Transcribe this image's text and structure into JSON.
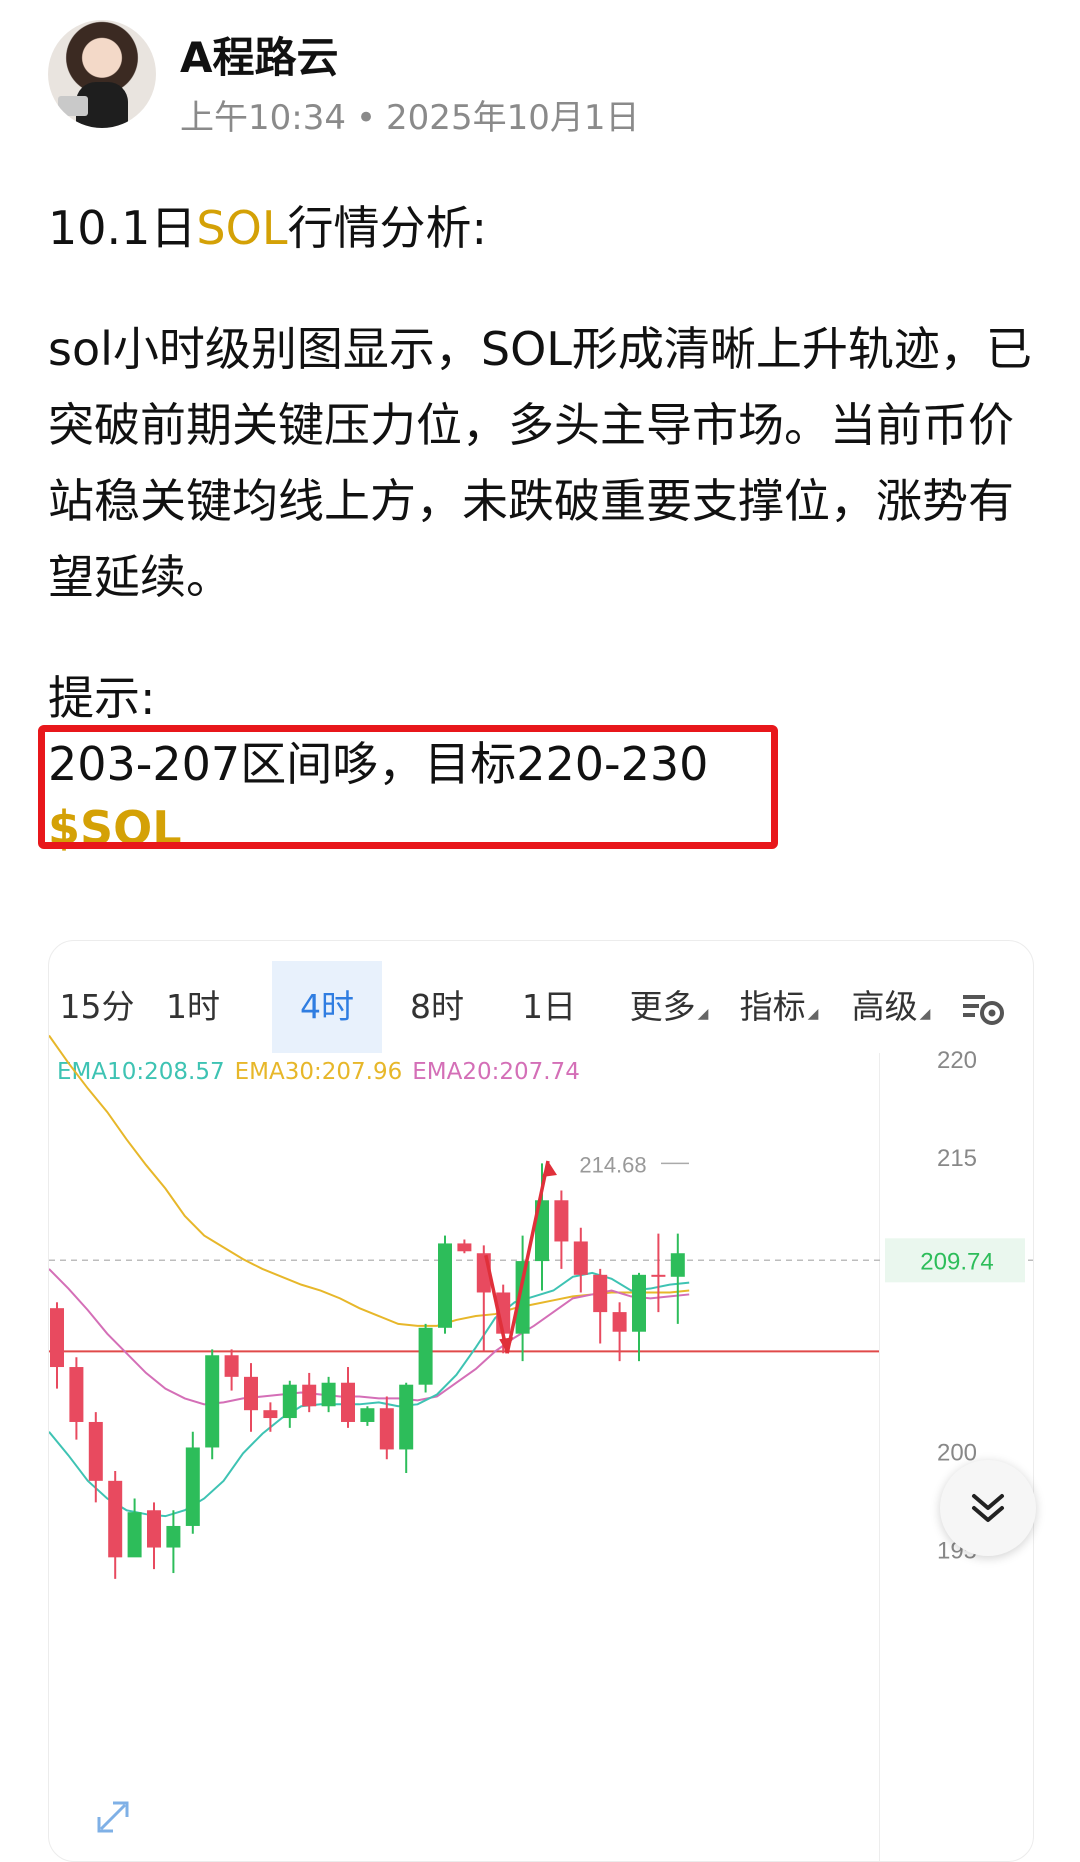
{
  "author": {
    "name": "A程路云",
    "time": "上午10:34",
    "separator": "•",
    "date": "2025年10月1日"
  },
  "post": {
    "title_prefix": "10.1日",
    "title_highlight": "SOL",
    "title_suffix": "行情分析:",
    "body": "sol小时级别图显示，SOL形成清晰上升轨迹，已突破前期关键压力位，多头主导市场。当前币价站稳关键均线上方，未跌破重要支撑位，涨势有望延续。",
    "hint_label": "提示:",
    "hint_text": "203-207区间哆，目标220-230",
    "tag": "$SOL"
  },
  "chart": {
    "tabs": [
      "15分",
      "1时",
      "4时",
      "8时",
      "1日",
      "更多",
      "指标",
      "高级"
    ],
    "active_tab": "4时",
    "settings_icon": "chart-settings-icon",
    "legend": {
      "ema10": "EMA10:208.57",
      "ema30": "EMA30:207.96",
      "ema20": "EMA20:207.74"
    },
    "price_labels": {
      "high": "214.68",
      "current": "209.74"
    },
    "colors": {
      "up": "#2dbd5a",
      "down": "#e84a5f",
      "ema10": "#3ec3b3",
      "ema30": "#e7b72a",
      "ema20": "#d46fb7",
      "support_line": "#e04a4a",
      "arrow": "#e0303a",
      "accent": "#2f7de1"
    }
  },
  "chart_data": {
    "type": "candlestick",
    "yticks": [
      220,
      215,
      200,
      195
    ],
    "ylim": [
      193.2,
      221.4
    ],
    "current_price": 209.74,
    "support_level": 205.1,
    "candles": [
      {
        "o": 207.3,
        "h": 207.6,
        "c": 204.3,
        "l": 203.2
      },
      {
        "o": 204.3,
        "h": 204.8,
        "c": 201.5,
        "l": 200.6
      },
      {
        "o": 201.5,
        "h": 202.0,
        "c": 198.5,
        "l": 197.4
      },
      {
        "o": 198.5,
        "h": 199.0,
        "c": 194.6,
        "l": 193.5
      },
      {
        "o": 194.6,
        "h": 197.6,
        "c": 196.9,
        "l": 195.6
      },
      {
        "o": 197.0,
        "h": 197.4,
        "c": 195.1,
        "l": 194.0
      },
      {
        "o": 195.1,
        "h": 197.0,
        "c": 196.2,
        "l": 193.8
      },
      {
        "o": 196.2,
        "h": 201.0,
        "c": 200.2,
        "l": 195.8
      },
      {
        "o": 200.2,
        "h": 205.2,
        "c": 204.9,
        "l": 199.6
      },
      {
        "o": 204.9,
        "h": 205.2,
        "c": 203.8,
        "l": 203.1
      },
      {
        "o": 203.8,
        "h": 204.5,
        "c": 202.1,
        "l": 201.0
      },
      {
        "o": 202.1,
        "h": 202.5,
        "c": 201.7,
        "l": 201.0
      },
      {
        "o": 201.7,
        "h": 203.6,
        "c": 203.4,
        "l": 201.2
      },
      {
        "o": 203.4,
        "h": 204.0,
        "c": 202.3,
        "l": 202.0
      },
      {
        "o": 202.3,
        "h": 203.8,
        "c": 203.5,
        "l": 202.0
      },
      {
        "o": 203.5,
        "h": 204.3,
        "c": 201.5,
        "l": 201.2
      },
      {
        "o": 201.5,
        "h": 202.3,
        "c": 202.2,
        "l": 201.3
      },
      {
        "o": 202.2,
        "h": 202.8,
        "c": 200.1,
        "l": 199.6
      },
      {
        "o": 200.1,
        "h": 203.5,
        "c": 203.4,
        "l": 198.9
      },
      {
        "o": 203.4,
        "h": 206.5,
        "c": 206.3,
        "l": 203.0
      },
      {
        "o": 206.3,
        "h": 211.0,
        "c": 210.6,
        "l": 206.0
      },
      {
        "o": 210.6,
        "h": 210.8,
        "c": 210.2,
        "l": 210.1
      },
      {
        "o": 210.1,
        "h": 210.5,
        "c": 208.1,
        "l": 205.1
      },
      {
        "o": 208.1,
        "h": 208.5,
        "c": 206.0,
        "l": 205.0
      },
      {
        "o": 206.0,
        "h": 211.0,
        "c": 209.7,
        "l": 204.6
      },
      {
        "o": 209.7,
        "h": 214.68,
        "c": 212.8,
        "l": 208.2
      },
      {
        "o": 212.8,
        "h": 213.3,
        "c": 210.7,
        "l": 209.3
      },
      {
        "o": 210.7,
        "h": 211.4,
        "c": 209.0,
        "l": 208.1
      },
      {
        "o": 209.0,
        "h": 209.3,
        "c": 207.1,
        "l": 205.5
      },
      {
        "o": 207.1,
        "h": 207.6,
        "c": 206.1,
        "l": 204.6
      },
      {
        "o": 206.1,
        "h": 209.1,
        "c": 209.0,
        "l": 204.6
      },
      {
        "o": 209.0,
        "h": 211.1,
        "c": 208.9,
        "l": 207.1
      },
      {
        "o": 208.9,
        "h": 211.1,
        "c": 210.1,
        "l": 206.5
      }
    ],
    "ema10": [
      201.0,
      199.8,
      198.5,
      197.6,
      197.0,
      196.8,
      196.7,
      197.0,
      197.6,
      198.5,
      199.9,
      200.9,
      201.7,
      202.3,
      202.4,
      202.4,
      202.4,
      202.5,
      202.3,
      202.4,
      202.9,
      203.9,
      205.3,
      206.8,
      207.6,
      207.9,
      208.2,
      208.9,
      209.1,
      208.8,
      208.2,
      208.3,
      208.5,
      208.6
    ],
    "ema20": [
      209.3,
      208.3,
      207.2,
      206.0,
      205.0,
      204.0,
      203.2,
      202.7,
      202.4,
      202.5,
      202.7,
      202.8,
      202.9,
      203.0,
      202.9,
      202.8,
      202.8,
      202.7,
      202.7,
      202.6,
      202.8,
      203.5,
      204.2,
      205.1,
      205.8,
      206.4,
      207.1,
      207.8,
      208.0,
      208.2,
      207.9,
      207.8,
      207.9,
      208.0
    ],
    "ema30": [
      221.2,
      219.8,
      218.5,
      217.3,
      215.9,
      214.6,
      213.4,
      212.0,
      211.0,
      210.4,
      209.8,
      209.3,
      208.9,
      208.5,
      208.2,
      207.8,
      207.3,
      206.9,
      206.5,
      206.4,
      206.4,
      206.7,
      206.9,
      207.0,
      207.3,
      207.5,
      207.7,
      207.9,
      208.0,
      208.1,
      208.1,
      208.1,
      208.1,
      208.2
    ]
  }
}
